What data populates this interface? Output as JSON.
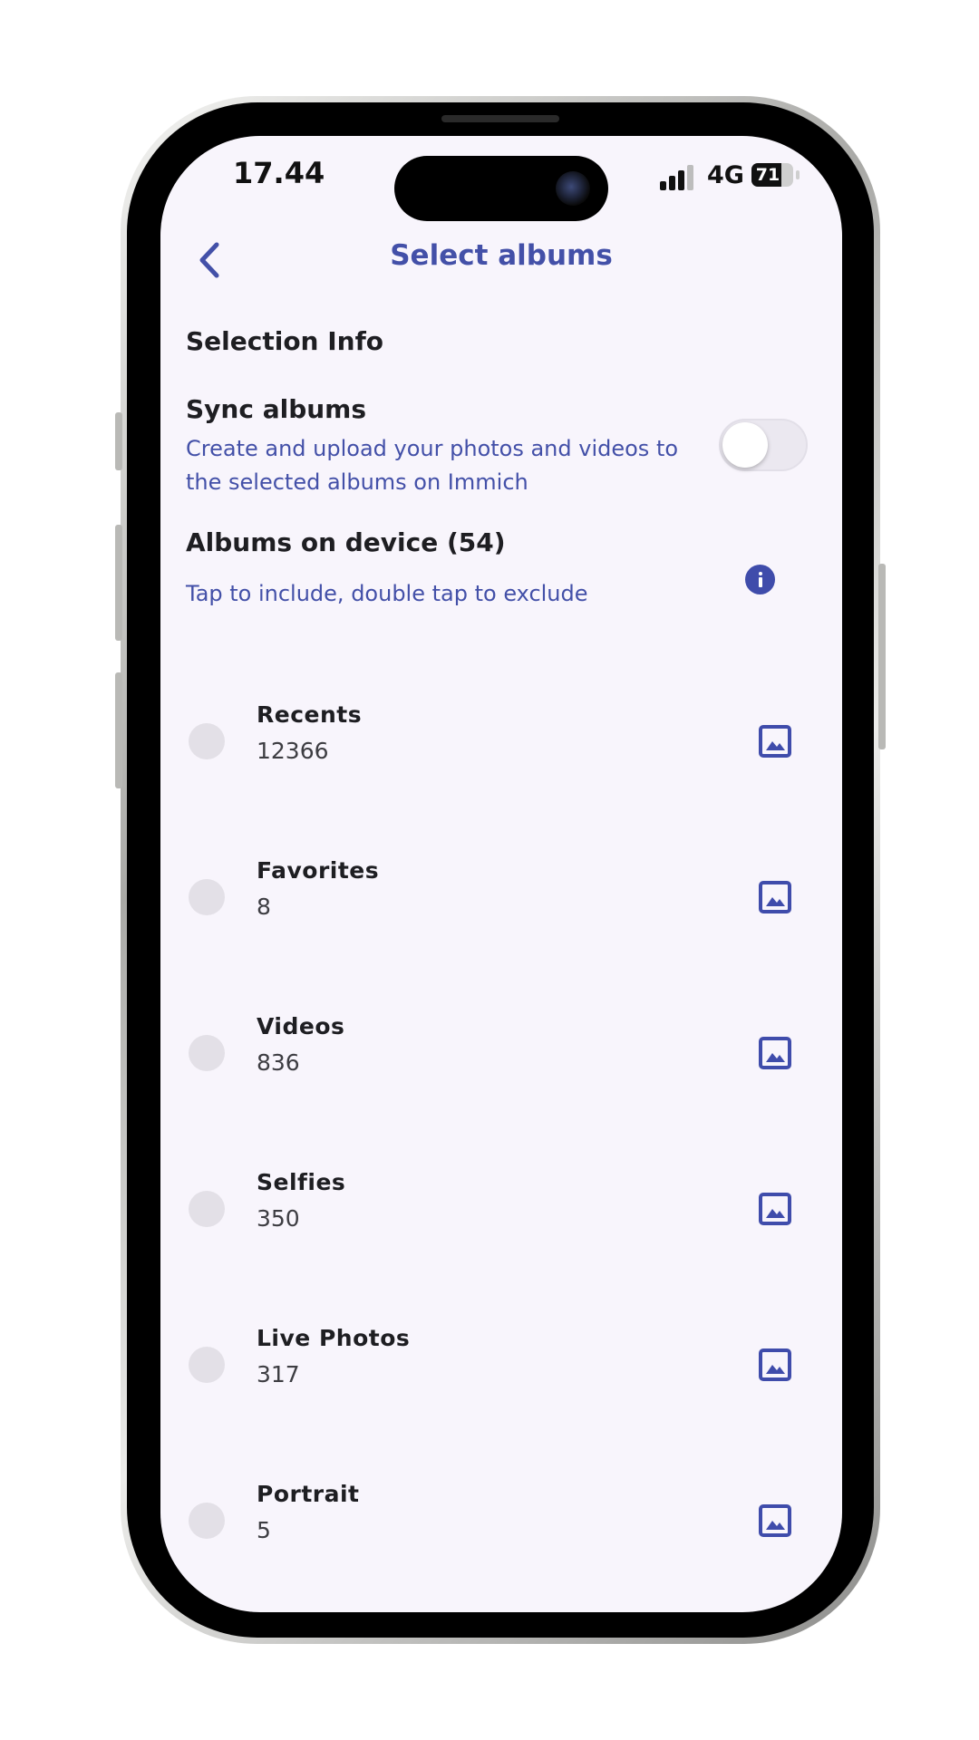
{
  "status_bar": {
    "time": "17.44",
    "network": "4G",
    "battery_level": 71,
    "battery_text": "71"
  },
  "header": {
    "title": "Select albums",
    "back_icon": "chevron-left-icon"
  },
  "selection_info": {
    "label": "Selection Info"
  },
  "sync": {
    "title": "Sync albums",
    "description": "Create and upload your photos and videos to the selected albums on Immich",
    "enabled": false
  },
  "albums": {
    "title": "Albums on device (54)",
    "hint": "Tap to include, double tap to exclude",
    "info_icon": "info-icon",
    "items": [
      {
        "name": "Recents",
        "count": "12366"
      },
      {
        "name": "Favorites",
        "count": "8"
      },
      {
        "name": "Videos",
        "count": "836"
      },
      {
        "name": "Selfies",
        "count": "350"
      },
      {
        "name": "Live Photos",
        "count": "317"
      },
      {
        "name": "Portrait",
        "count": "5"
      }
    ]
  },
  "colors": {
    "accent": "#4350a8",
    "background": "#f8f5fc",
    "text": "#1e1e22"
  }
}
